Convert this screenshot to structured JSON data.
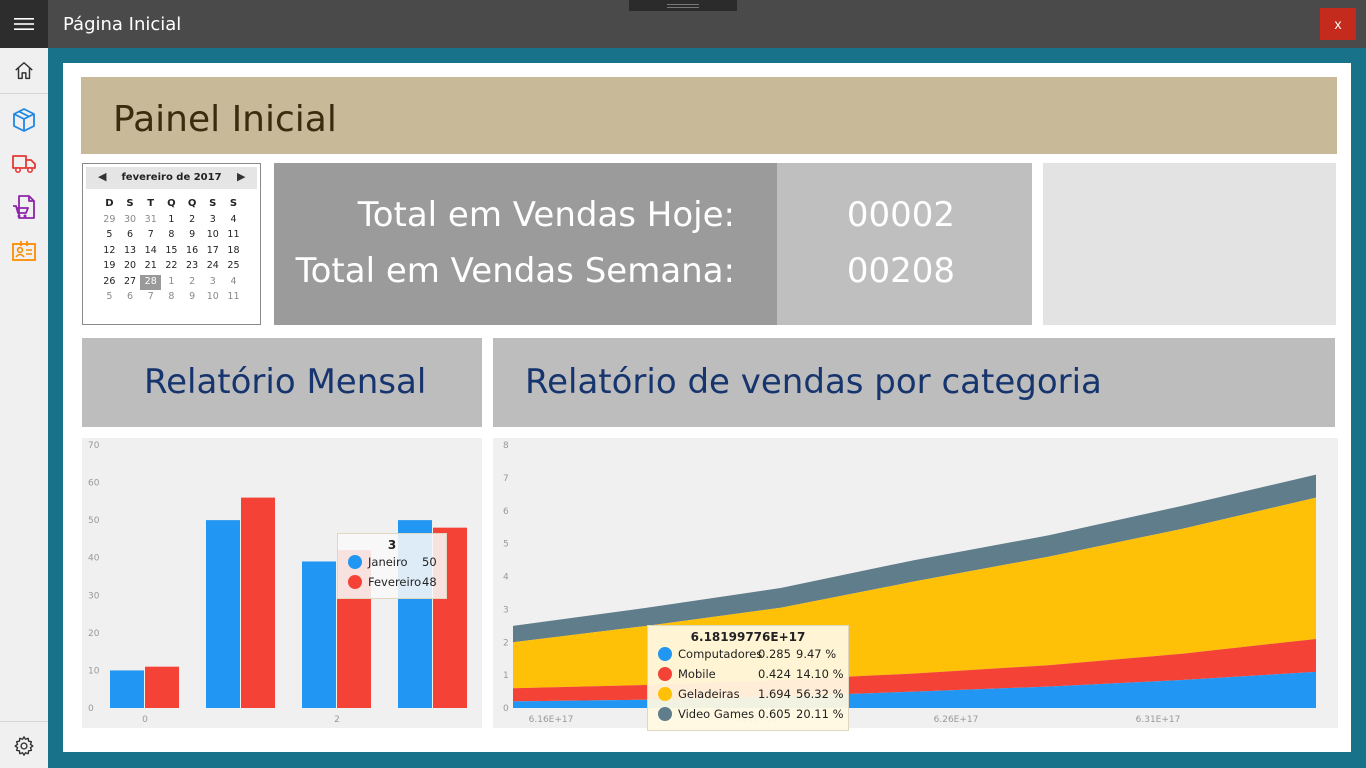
{
  "app": {
    "title": "Página Inicial",
    "close_label": "x"
  },
  "sidebar": {
    "items": [
      {
        "name": "home",
        "color": "#333333"
      },
      {
        "name": "products",
        "color": "#1e88e5"
      },
      {
        "name": "delivery",
        "color": "#e53935"
      },
      {
        "name": "purchases",
        "color": "#8e24aa"
      },
      {
        "name": "contacts",
        "color": "#fb8c00"
      }
    ]
  },
  "page": {
    "title": "Painel Inicial"
  },
  "calendar": {
    "month_label": "fevereiro de 2017",
    "day_headers": [
      "D",
      "S",
      "T",
      "Q",
      "Q",
      "S",
      "S"
    ],
    "weeks": [
      [
        "29",
        "30",
        "31",
        "1",
        "2",
        "3",
        "4"
      ],
      [
        "5",
        "6",
        "7",
        "8",
        "9",
        "10",
        "11"
      ],
      [
        "12",
        "13",
        "14",
        "15",
        "16",
        "17",
        "18"
      ],
      [
        "19",
        "20",
        "21",
        "22",
        "23",
        "24",
        "25"
      ],
      [
        "26",
        "27",
        "28",
        "1",
        "2",
        "3",
        "4"
      ],
      [
        "5",
        "6",
        "7",
        "8",
        "9",
        "10",
        "11"
      ]
    ],
    "selected": "28"
  },
  "sales": {
    "today_label": "Total em Vendas Hoje:",
    "today_value": "00002",
    "week_label": "Total em Vendas Semana:",
    "week_value": "00208"
  },
  "monthly_report": {
    "title": "Relatório Mensal"
  },
  "category_report": {
    "title": "Relatório de vendas por categoria"
  },
  "chart_data": [
    {
      "type": "bar",
      "categories": [
        "0",
        "1",
        "2",
        "3"
      ],
      "x_tick_labels": [
        "0",
        "2"
      ],
      "y_ticks": [
        "0",
        "10",
        "20",
        "30",
        "40",
        "50",
        "60",
        "70"
      ],
      "ylim": [
        0,
        70
      ],
      "series": [
        {
          "name": "Janeiro",
          "color": "#2196f3",
          "values": [
            10,
            50,
            39,
            50
          ]
        },
        {
          "name": "Fevereiro",
          "color": "#f44336",
          "values": [
            11,
            56,
            42,
            48
          ]
        }
      ],
      "tooltip": {
        "title": "3",
        "rows": [
          {
            "name": "Janeiro",
            "value": "50",
            "color": "#2196f3"
          },
          {
            "name": "Fevereiro",
            "value": "48",
            "color": "#f44336"
          }
        ]
      }
    },
    {
      "type": "area",
      "stacked": true,
      "x_tick_labels": [
        "6.16E+17",
        "6.21E+17",
        "6.26E+17",
        "6.31E+17"
      ],
      "y_ticks": [
        "0",
        "1",
        "2",
        "3",
        "4",
        "5",
        "6",
        "7",
        "8"
      ],
      "ylim": [
        0,
        8
      ],
      "x": [
        0,
        1,
        2,
        3,
        4,
        5,
        6
      ],
      "series": [
        {
          "name": "Computadores",
          "color": "#2196f3",
          "values": [
            0.2,
            0.25,
            0.35,
            0.5,
            0.65,
            0.85,
            1.1
          ]
        },
        {
          "name": "Mobile",
          "color": "#f44336",
          "values": [
            0.4,
            0.45,
            0.5,
            0.55,
            0.65,
            0.8,
            1.0
          ]
        },
        {
          "name": "Geladeiras",
          "color": "#ffc107",
          "values": [
            1.4,
            1.8,
            2.2,
            2.8,
            3.3,
            3.8,
            4.3
          ]
        },
        {
          "name": "Video Games",
          "color": "#607d8b",
          "values": [
            0.5,
            0.55,
            0.6,
            0.65,
            0.65,
            0.7,
            0.7
          ]
        }
      ],
      "tooltip": {
        "title": "6.18199776E+17",
        "rows": [
          {
            "name": "Computadores",
            "value": "0.285",
            "pct": "9.47 %",
            "color": "#2196f3"
          },
          {
            "name": "Mobile",
            "value": "0.424",
            "pct": "14.10 %",
            "color": "#f44336"
          },
          {
            "name": "Geladeiras",
            "value": "1.694",
            "pct": "56.32 %",
            "color": "#ffc107"
          },
          {
            "name": "Video Games",
            "value": "0.605",
            "pct": "20.11 %",
            "color": "#607d8b"
          }
        ]
      }
    }
  ]
}
